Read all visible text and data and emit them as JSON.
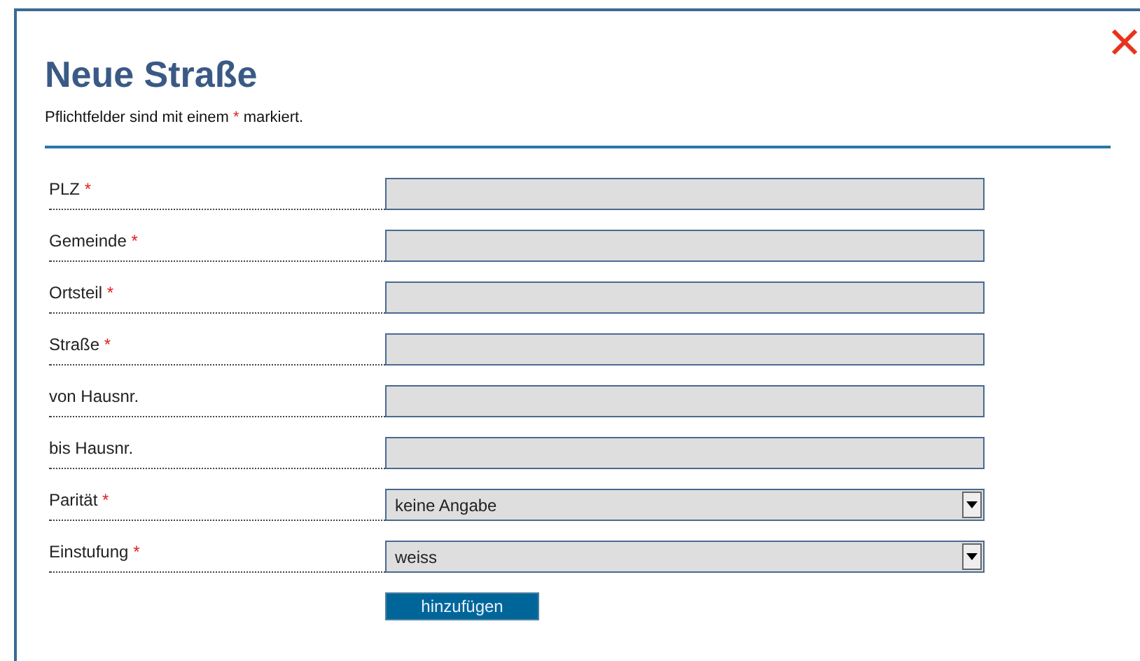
{
  "dialog": {
    "title": "Neue Straße",
    "note_before": "Pflichtfelder sind mit einem",
    "note_star": "*",
    "note_after": "markiert."
  },
  "fields": [
    {
      "label": "PLZ",
      "required": true,
      "kind": "text"
    },
    {
      "label": "Gemeinde",
      "required": true,
      "kind": "text"
    },
    {
      "label": "Ortsteil",
      "required": true,
      "kind": "text"
    },
    {
      "label": "Straße",
      "required": true,
      "kind": "text"
    },
    {
      "label": "von Hausnr.",
      "required": false,
      "kind": "text"
    },
    {
      "label": "bis Hausnr.",
      "required": false,
      "kind": "text"
    },
    {
      "label": "Parität",
      "required": true,
      "kind": "select",
      "value": "keine Angabe"
    },
    {
      "label": "Einstufung",
      "required": true,
      "kind": "select",
      "value": "weiss"
    }
  ],
  "required_mark": "*",
  "submit": "hinzufügen"
}
